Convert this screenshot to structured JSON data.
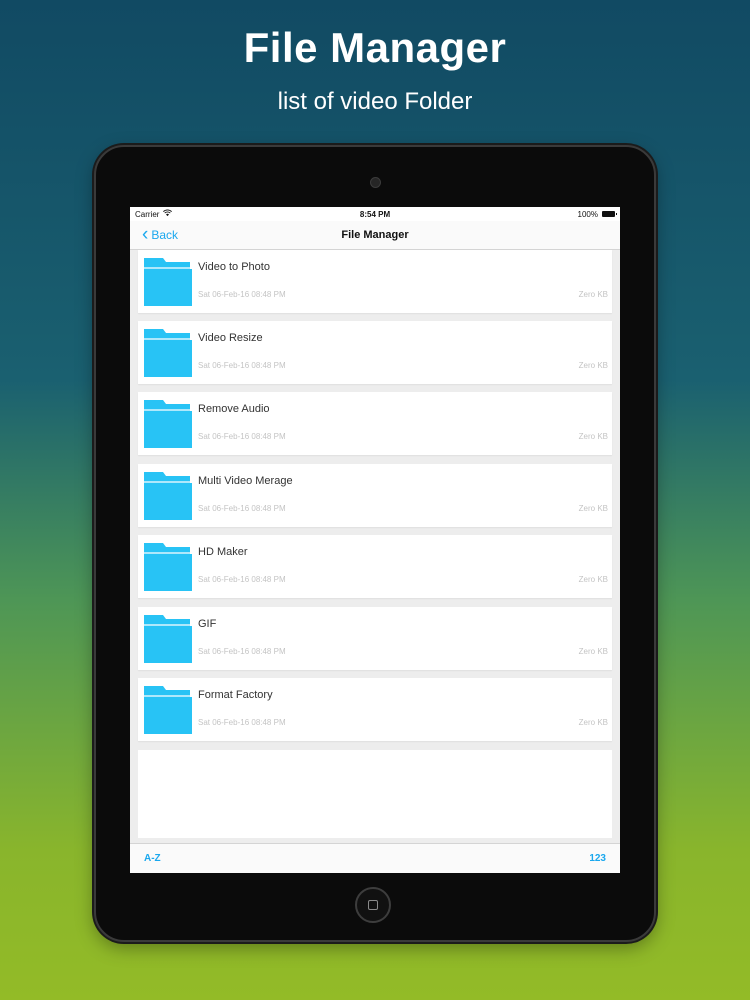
{
  "promo": {
    "title": "File Manager",
    "subtitle": "list of video Folder"
  },
  "status_bar": {
    "carrier": "Carrier",
    "time": "8:54 PM",
    "battery": "100%",
    "icons": [
      "wifi-icon",
      "battery-icon"
    ]
  },
  "nav": {
    "back_label": "Back",
    "title": "File Manager"
  },
  "folders": [
    {
      "name": "Video to Photo",
      "date": "Sat 06-Feb-16 08:48 PM",
      "size": "Zero KB"
    },
    {
      "name": "Video Resize",
      "date": "Sat 06-Feb-16 08:48 PM",
      "size": "Zero KB"
    },
    {
      "name": "Remove Audio",
      "date": "Sat 06-Feb-16 08:48 PM",
      "size": "Zero KB"
    },
    {
      "name": "Multi Video Merage",
      "date": "Sat 06-Feb-16 08:48 PM",
      "size": "Zero KB"
    },
    {
      "name": "HD Maker",
      "date": "Sat 06-Feb-16 08:48 PM",
      "size": "Zero KB"
    },
    {
      "name": "GIF",
      "date": "Sat 06-Feb-16 08:48 PM",
      "size": "Zero KB"
    },
    {
      "name": "Format Factory",
      "date": "Sat 06-Feb-16 08:48 PM",
      "size": "Zero KB"
    }
  ],
  "bottom_bar": {
    "sort_alpha": "A-Z",
    "sort_numeric": "123"
  },
  "colors": {
    "accent": "#1aa8ee",
    "folder": "#28c3f5"
  }
}
